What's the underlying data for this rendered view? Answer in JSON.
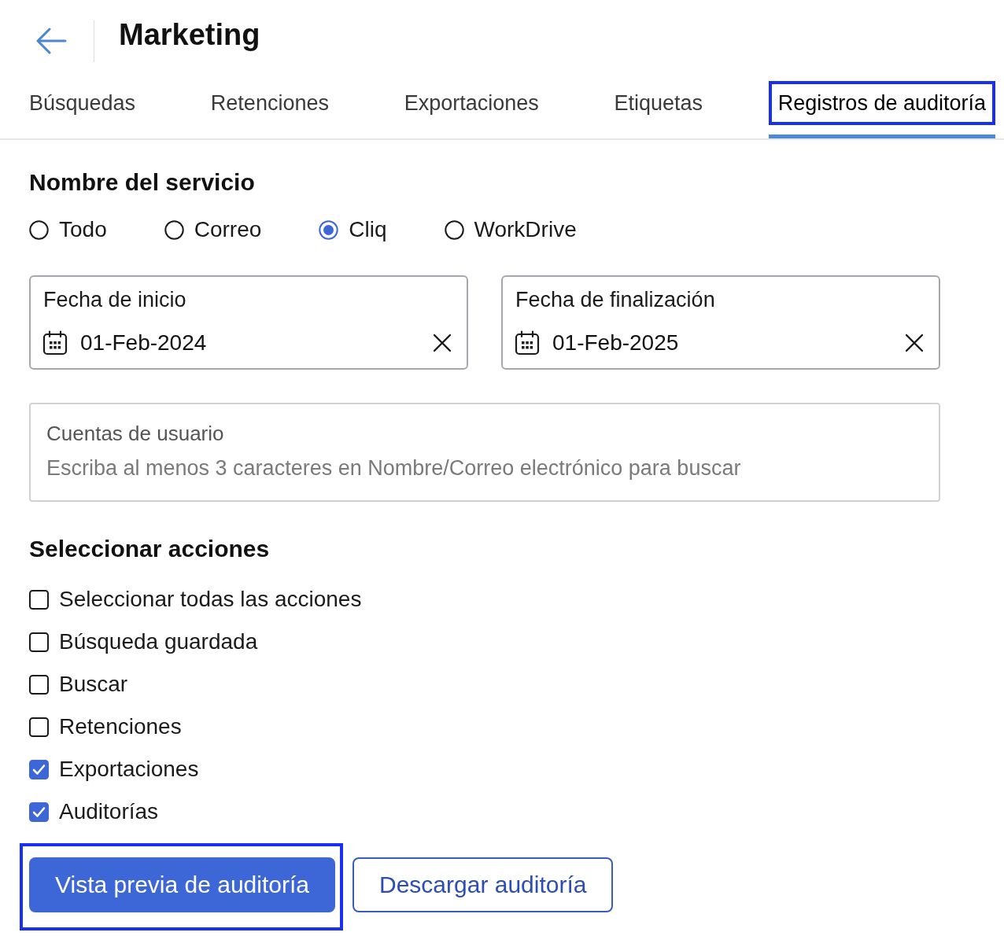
{
  "header": {
    "title": "Marketing"
  },
  "tabs": [
    {
      "label": "Búsquedas",
      "selected": false,
      "highlighted": false
    },
    {
      "label": "Retenciones",
      "selected": false,
      "highlighted": false
    },
    {
      "label": "Exportaciones",
      "selected": false,
      "highlighted": false
    },
    {
      "label": "Etiquetas",
      "selected": false,
      "highlighted": false
    },
    {
      "label": "Registros de auditoría",
      "selected": true,
      "highlighted": true
    }
  ],
  "service": {
    "heading": "Nombre del servicio",
    "options": [
      {
        "label": "Todo",
        "selected": false
      },
      {
        "label": "Correo",
        "selected": false
      },
      {
        "label": "Cliq",
        "selected": true
      },
      {
        "label": "WorkDrive",
        "selected": false
      }
    ]
  },
  "dates": [
    {
      "label": "Fecha de inicio",
      "value": "01-Feb-2024"
    },
    {
      "label": "Fecha de finalización",
      "value": "01-Feb-2025"
    }
  ],
  "user_accounts": {
    "label": "Cuentas de usuario",
    "placeholder": "Escriba al menos 3 caracteres en Nombre/Correo electrónico para buscar"
  },
  "actions": {
    "heading": "Seleccionar acciones",
    "items": [
      {
        "label": "Seleccionar todas las acciones",
        "checked": false
      },
      {
        "label": "Búsqueda guardada",
        "checked": false
      },
      {
        "label": "Buscar",
        "checked": false
      },
      {
        "label": "Retenciones",
        "checked": false
      },
      {
        "label": "Exportaciones",
        "checked": true
      },
      {
        "label": "Auditorías",
        "checked": true
      }
    ]
  },
  "buttons": [
    {
      "label": "Vista previa de auditoría",
      "kind": "primary",
      "highlighted": true
    },
    {
      "label": "Descargar auditoría",
      "kind": "secondary",
      "highlighted": false
    }
  ]
}
